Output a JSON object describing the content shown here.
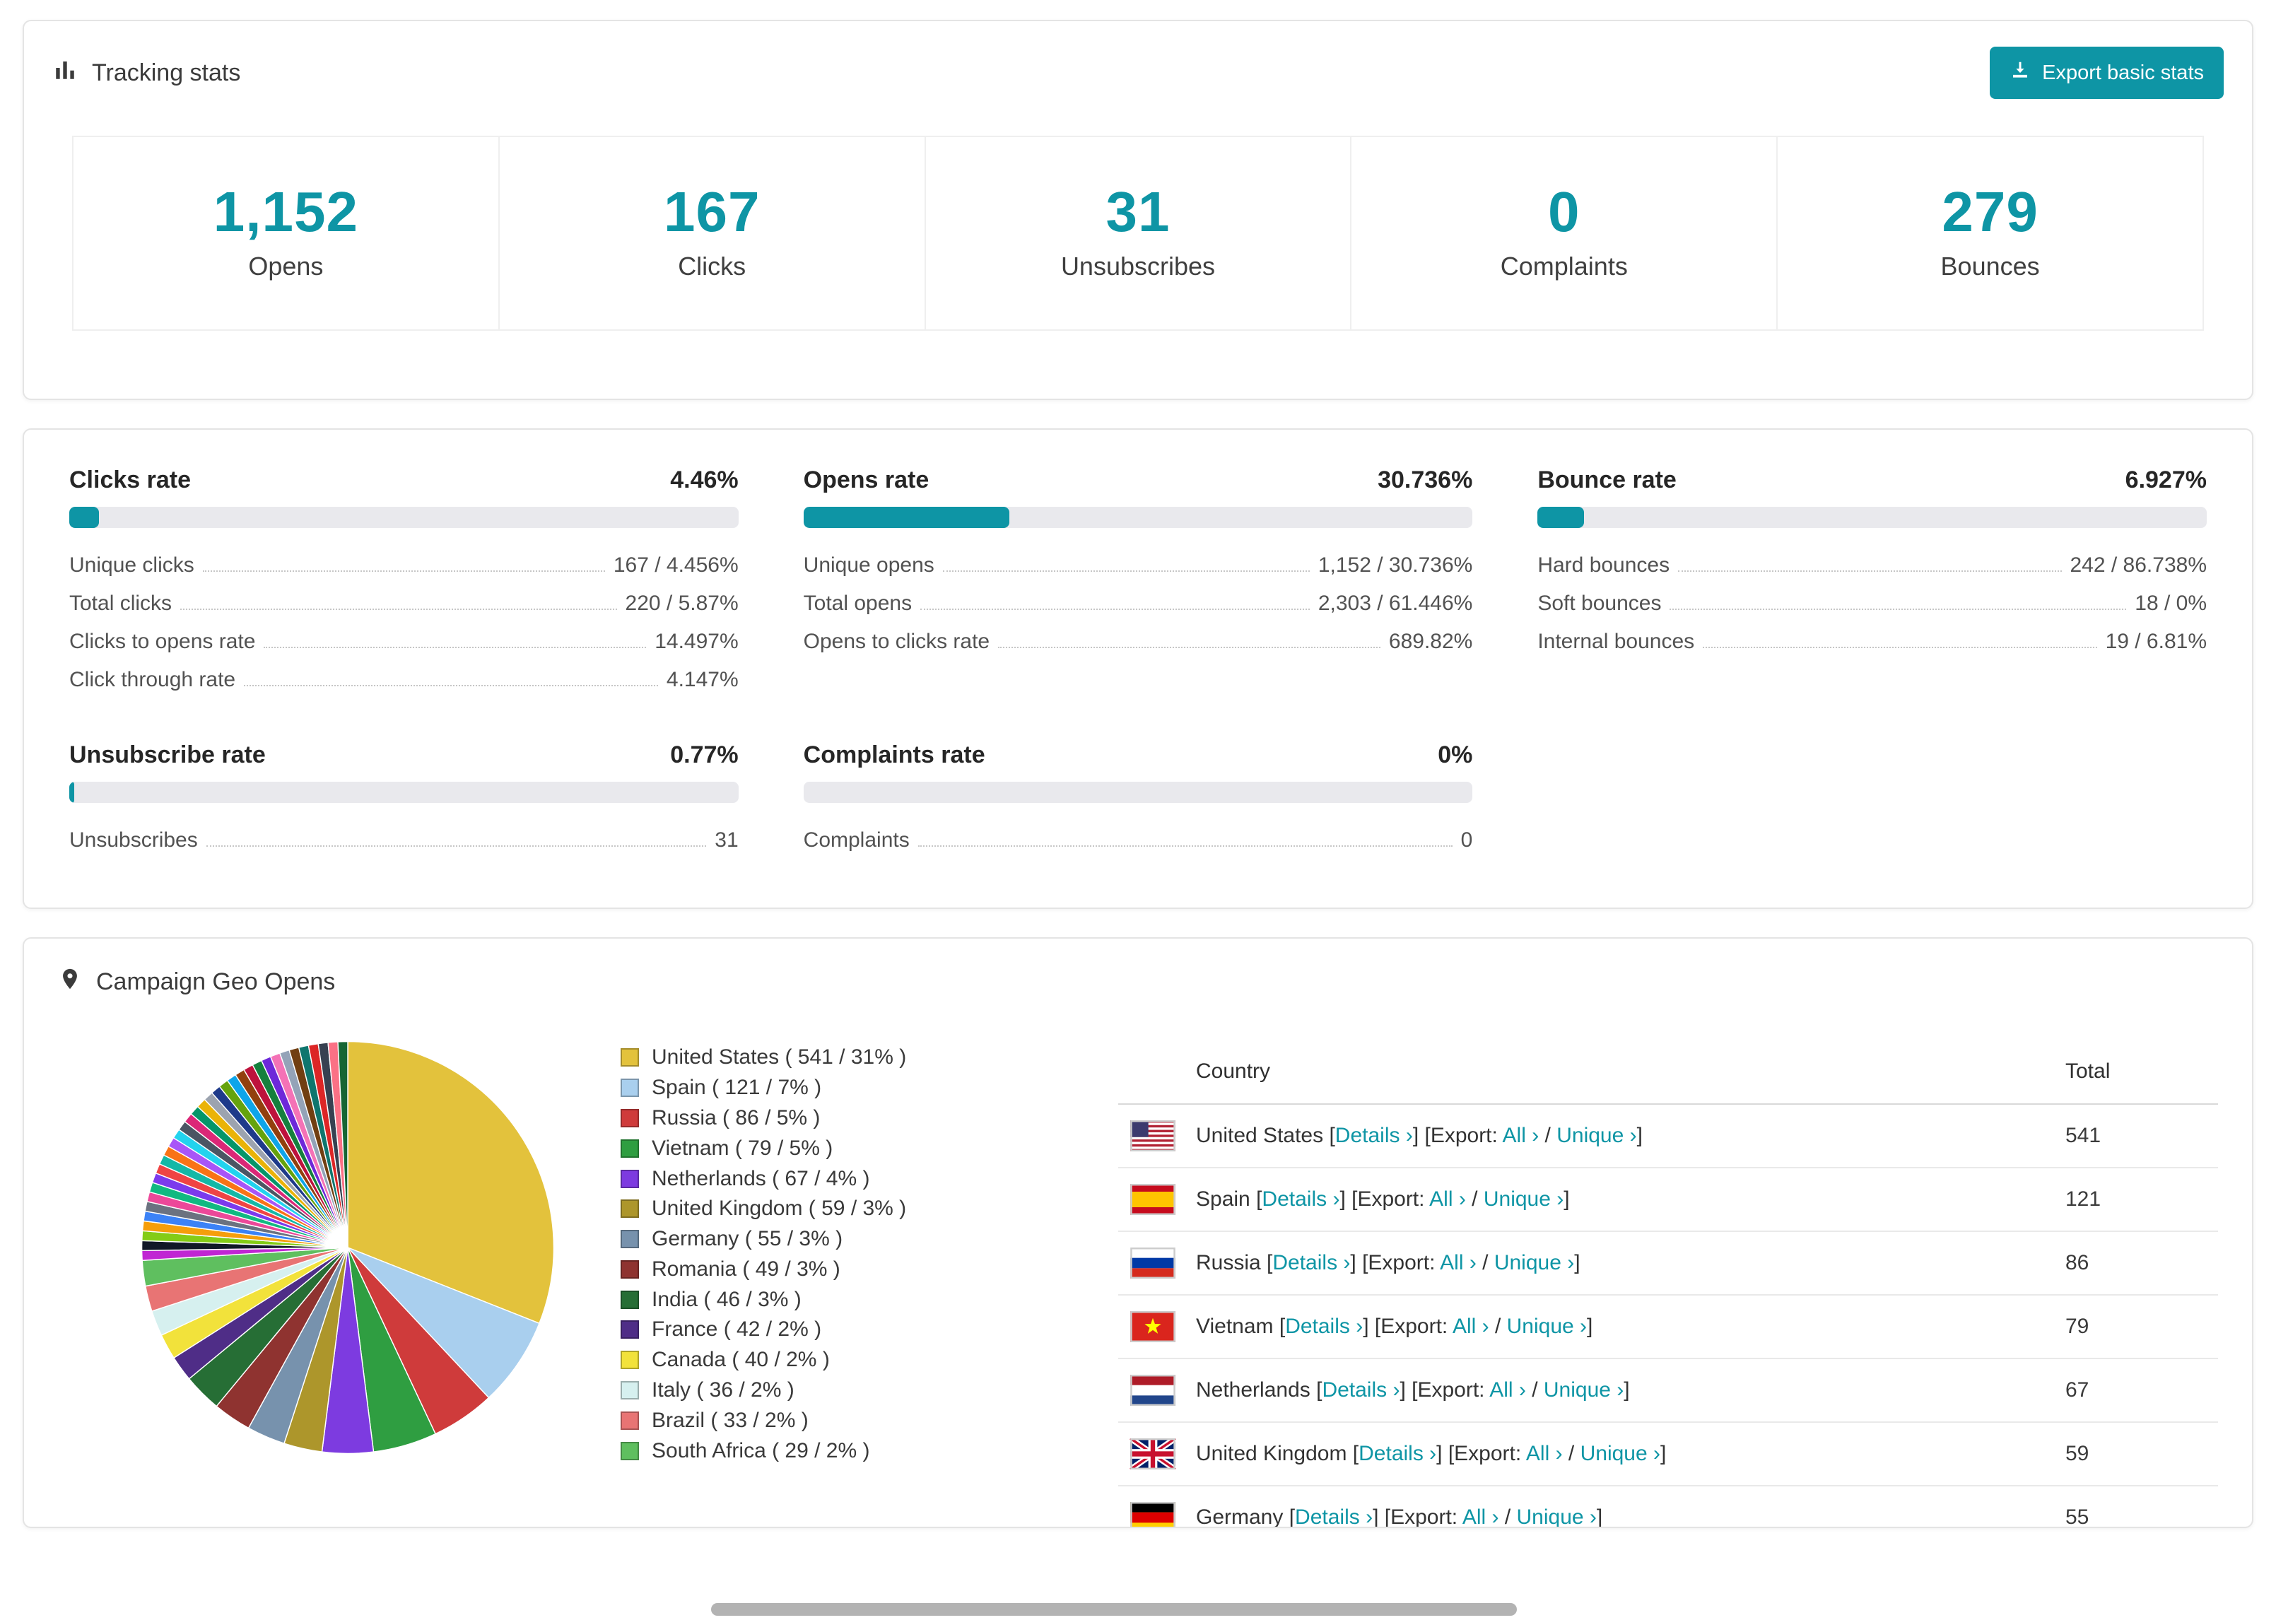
{
  "colors": {
    "accent": "#0e95a5",
    "bar_track": "#e9e9ed",
    "link": "#0e95a5"
  },
  "tracking": {
    "title": "Tracking stats",
    "export_button": "Export basic stats",
    "stats": [
      {
        "value": "1,152",
        "label": "Opens"
      },
      {
        "value": "167",
        "label": "Clicks"
      },
      {
        "value": "31",
        "label": "Unsubscribes"
      },
      {
        "value": "0",
        "label": "Complaints"
      },
      {
        "value": "279",
        "label": "Bounces"
      }
    ]
  },
  "rates": [
    {
      "title": "Clicks rate",
      "value": "4.46%",
      "percent": 4.46,
      "rows": [
        {
          "label": "Unique clicks",
          "value": "167 / 4.456%"
        },
        {
          "label": "Total clicks",
          "value": "220 / 5.87%"
        },
        {
          "label": "Clicks to opens rate",
          "value": "14.497%"
        },
        {
          "label": "Click through rate",
          "value": "4.147%"
        }
      ]
    },
    {
      "title": "Opens rate",
      "value": "30.736%",
      "percent": 30.736,
      "rows": [
        {
          "label": "Unique opens",
          "value": "1,152 / 30.736%"
        },
        {
          "label": "Total opens",
          "value": "2,303 / 61.446%"
        },
        {
          "label": "Opens to clicks rate",
          "value": "689.82%"
        }
      ]
    },
    {
      "title": "Bounce rate",
      "value": "6.927%",
      "percent": 6.927,
      "rows": [
        {
          "label": "Hard bounces",
          "value": "242 / 86.738%"
        },
        {
          "label": "Soft bounces",
          "value": "18 / 0%"
        },
        {
          "label": "Internal bounces",
          "value": "19 / 6.81%"
        }
      ]
    },
    {
      "title": "Unsubscribe rate",
      "value": "0.77%",
      "percent": 0.77,
      "rows": [
        {
          "label": "Unsubscribes",
          "value": "31"
        }
      ]
    },
    {
      "title": "Complaints rate",
      "value": "0%",
      "percent": 0,
      "rows": [
        {
          "label": "Complaints",
          "value": "0"
        }
      ]
    }
  ],
  "geo": {
    "title": "Campaign Geo Opens",
    "chart_data": {
      "type": "pie",
      "title": "Campaign Geo Opens",
      "slices": [
        {
          "label": "United States",
          "value": 541,
          "percent": 31,
          "color": "#e3c23c"
        },
        {
          "label": "Spain",
          "value": 121,
          "percent": 7,
          "color": "#a9cfee"
        },
        {
          "label": "Russia",
          "value": 86,
          "percent": 5,
          "color": "#cf3b3b"
        },
        {
          "label": "Vietnam",
          "value": 79,
          "percent": 5,
          "color": "#2f9e41"
        },
        {
          "label": "Netherlands",
          "value": 67,
          "percent": 4,
          "color": "#7d3be0"
        },
        {
          "label": "United Kingdom",
          "value": 59,
          "percent": 3,
          "color": "#ad962b"
        },
        {
          "label": "Germany",
          "value": 55,
          "percent": 3,
          "color": "#7792ad"
        },
        {
          "label": "Romania",
          "value": 49,
          "percent": 3,
          "color": "#8f3330"
        },
        {
          "label": "India",
          "value": 46,
          "percent": 3,
          "color": "#266e35"
        },
        {
          "label": "France",
          "value": 42,
          "percent": 2,
          "color": "#4f2d87"
        },
        {
          "label": "Canada",
          "value": 40,
          "percent": 2,
          "color": "#f2e23b"
        },
        {
          "label": "Italy",
          "value": 36,
          "percent": 2,
          "color": "#d6f0ef"
        },
        {
          "label": "Brazil",
          "value": 33,
          "percent": 2,
          "color": "#e87474"
        },
        {
          "label": "South Africa",
          "value": 29,
          "percent": 2,
          "color": "#5fbf5f"
        }
      ],
      "others_percent": 26,
      "other_colors": [
        "#c026d3",
        "#111827",
        "#84cc16",
        "#f59e0b",
        "#3b82f6",
        "#6b7280",
        "#ec4899",
        "#10b981",
        "#7c3aed",
        "#ef4444",
        "#14b8a6",
        "#f97316",
        "#a855f7",
        "#22d3ee",
        "#4b5563",
        "#db2777",
        "#059669",
        "#eab308",
        "#9ca3af",
        "#1e3a8a",
        "#65a30d",
        "#0ea5e9",
        "#92400e",
        "#be123c",
        "#15803d",
        "#6d28d9",
        "#f472b6",
        "#94a3b8",
        "#713f12",
        "#0f766e",
        "#dc2626",
        "#374151",
        "#fb7185",
        "#166534"
      ]
    },
    "legend_format": {
      "open": " ( ",
      "slash": " / ",
      "close": "% )"
    },
    "table": {
      "headers": {
        "country": "Country",
        "total": "Total"
      },
      "links": {
        "details": "Details ›",
        "all": "All ›",
        "unique": "Unique ›"
      },
      "segments": {
        "open": " [",
        "export": "] [Export: ",
        "slash": " / ",
        "close": "]"
      },
      "rows": [
        {
          "country": "United States",
          "flag": "us",
          "total": "541"
        },
        {
          "country": "Spain",
          "flag": "es",
          "total": "121"
        },
        {
          "country": "Russia",
          "flag": "ru",
          "total": "86"
        },
        {
          "country": "Vietnam",
          "flag": "vn",
          "total": "79"
        },
        {
          "country": "Netherlands",
          "flag": "nl",
          "total": "67"
        },
        {
          "country": "United Kingdom",
          "flag": "gb",
          "total": "59"
        },
        {
          "country": "Germany",
          "flag": "de",
          "total": "55"
        }
      ]
    }
  }
}
